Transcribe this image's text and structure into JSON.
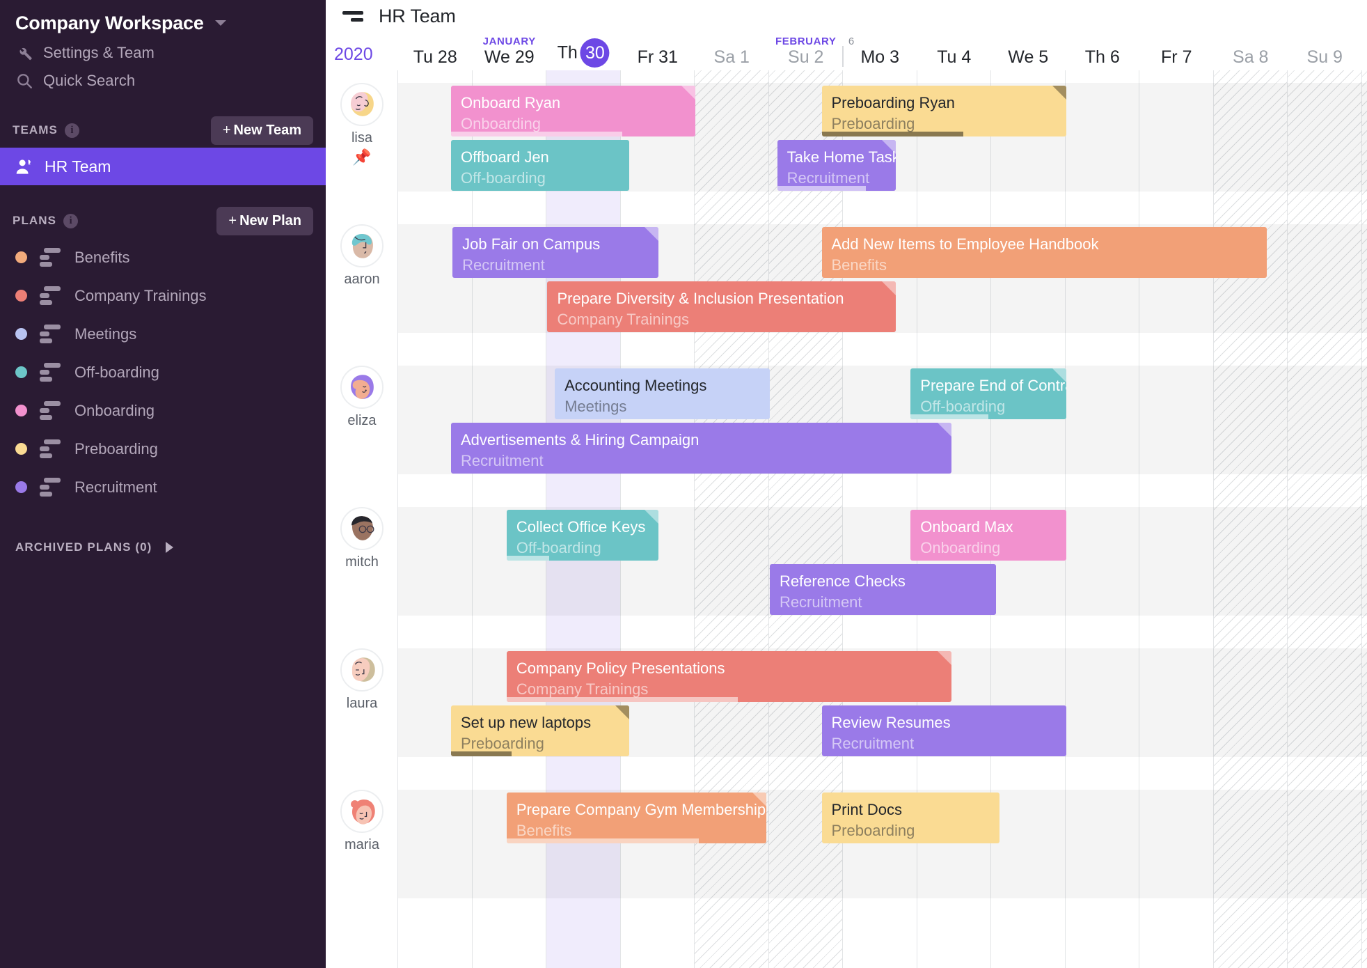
{
  "sidebar": {
    "workspace_title": "Company Workspace",
    "caret_icon": "chevron-down-icon",
    "links": [
      {
        "label": "Settings & Team",
        "icon": "wrench-icon"
      },
      {
        "label": "Quick Search",
        "icon": "search-icon"
      }
    ],
    "teams_section": {
      "title": "TEAMS",
      "info_icon": "info-icon",
      "new_button": "New Team",
      "plus": "+"
    },
    "teams": [
      {
        "label": "HR Team",
        "icon": "team-people-icon",
        "selected": true
      }
    ],
    "plans_section": {
      "title": "PLANS",
      "info_icon": "info-icon",
      "new_button": "New Plan",
      "plus": "+"
    },
    "plans": [
      {
        "label": "Benefits",
        "color": "#f2ab7c"
      },
      {
        "label": "Company Trainings",
        "color": "#ed7f76"
      },
      {
        "label": "Meetings",
        "color": "#b9c4f2"
      },
      {
        "label": "Off-boarding",
        "color": "#6cc6c8"
      },
      {
        "label": "Onboarding",
        "color": "#f291ce"
      },
      {
        "label": "Preboarding",
        "color": "#fadb93"
      },
      {
        "label": "Recruitment",
        "color": "#9a7ae8"
      }
    ],
    "archived": {
      "label": "ARCHIVED PLANS (0)",
      "arrow_icon": "chevron-right-icon"
    }
  },
  "header": {
    "sort_icon": "sort-lines-icon",
    "title": "HR Team"
  },
  "timeline": {
    "year": "2020",
    "months": [
      {
        "label": "JANUARY",
        "col": 1
      },
      {
        "label": "FEBRUARY",
        "col": 5
      }
    ],
    "week_number": "6",
    "week_sep_after_col": 6,
    "days": [
      {
        "label": "Tu 28",
        "weekend": false,
        "today": false
      },
      {
        "label": "We 29",
        "weekend": false,
        "today": false
      },
      {
        "label": "Th",
        "day": "30",
        "weekend": false,
        "today": true
      },
      {
        "label": "Fr 31",
        "weekend": false,
        "today": false
      },
      {
        "label": "Sa 1",
        "weekend": true,
        "today": false
      },
      {
        "label": "Su 2",
        "weekend": true,
        "today": false
      },
      {
        "label": "Mo 3",
        "weekend": false,
        "today": false
      },
      {
        "label": "Tu 4",
        "weekend": false,
        "today": false
      },
      {
        "label": "We 5",
        "weekend": false,
        "today": false
      },
      {
        "label": "Th 6",
        "weekend": false,
        "today": false
      },
      {
        "label": "Fr 7",
        "weekend": false,
        "today": false
      },
      {
        "label": "Sa 8",
        "weekend": true,
        "today": false
      },
      {
        "label": "Su 9",
        "weekend": true,
        "today": false
      }
    ]
  },
  "plan_colors": {
    "Benefits": "#f2a077",
    "Company Trainings": "#ec7f77",
    "Meetings": "#c6d2f7",
    "Off-boarding": "#6bc4c6",
    "Onboarding": "#f291ce",
    "Preboarding": "#fadb93",
    "Recruitment": "#9a7ae8"
  },
  "rows": [
    {
      "person": "lisa",
      "avatar": "avatar-lisa",
      "pinned": true,
      "pin_icon": "pushpin-icon",
      "tasks": [
        {
          "title": "Onboard Ryan",
          "plan": "Onboarding",
          "start": 1.0,
          "end": 4.3,
          "lane": 0,
          "progress": 70,
          "corner": true,
          "text": "light"
        },
        {
          "title": "Preboarding Ryan",
          "plan": "Preboarding",
          "start": 6.0,
          "end": 9.3,
          "lane": 0,
          "progress": 58,
          "corner": true,
          "text": "dark"
        },
        {
          "title": "Offboard Jen",
          "plan": "Off-boarding",
          "start": 1.0,
          "end": 3.4,
          "lane": 1,
          "progress": 0,
          "corner": false,
          "text": "light"
        },
        {
          "title": "Take Home Task",
          "plan": "Recruitment",
          "start": 5.4,
          "end": 7.0,
          "lane": 1,
          "progress": 75,
          "corner": true,
          "text": "light"
        }
      ]
    },
    {
      "person": "aaron",
      "avatar": "avatar-aaron",
      "pinned": false,
      "tasks": [
        {
          "title": "Job Fair on Campus",
          "plan": "Recruitment",
          "start": 1.02,
          "end": 3.8,
          "lane": 0,
          "progress": 0,
          "corner": true,
          "text": "light"
        },
        {
          "title": "Add New Items to Employee Handbook",
          "plan": "Benefits",
          "start": 6.0,
          "end": 12.0,
          "lane": 0,
          "progress": 0,
          "corner": false,
          "text": "light"
        },
        {
          "title": "Prepare Diversity & Inclusion Presentation",
          "plan": "Company Trainings",
          "start": 2.3,
          "end": 7.0,
          "lane": 1,
          "progress": 0,
          "corner": true,
          "text": "light"
        }
      ]
    },
    {
      "person": "eliza",
      "avatar": "avatar-eliza",
      "pinned": false,
      "tasks": [
        {
          "title": "Accounting Meetings",
          "plan": "Meetings",
          "start": 2.4,
          "end": 5.3,
          "lane": 0,
          "progress": 0,
          "corner": false,
          "text": "dark"
        },
        {
          "title": "Prepare End of Contract",
          "plan": "Off-boarding",
          "start": 7.2,
          "end": 9.3,
          "lane": 0,
          "progress": 50,
          "corner": true,
          "text": "light"
        },
        {
          "title": "Advertisements & Hiring Campaign",
          "plan": "Recruitment",
          "start": 1.0,
          "end": 7.75,
          "lane": 1,
          "progress": 0,
          "corner": true,
          "text": "light"
        }
      ]
    },
    {
      "person": "mitch",
      "avatar": "avatar-mitch",
      "pinned": false,
      "tasks": [
        {
          "title": "Collect Office Keys",
          "plan": "Off-boarding",
          "start": 1.75,
          "end": 3.8,
          "lane": 0,
          "progress": 28,
          "corner": true,
          "text": "light"
        },
        {
          "title": "Onboard Max",
          "plan": "Onboarding",
          "start": 7.2,
          "end": 9.3,
          "lane": 0,
          "progress": 0,
          "corner": false,
          "text": "light"
        },
        {
          "title": "Reference Checks",
          "plan": "Recruitment",
          "start": 5.3,
          "end": 8.35,
          "lane": 1,
          "progress": 0,
          "corner": false,
          "text": "light"
        }
      ]
    },
    {
      "person": "laura",
      "avatar": "avatar-laura",
      "pinned": false,
      "tasks": [
        {
          "title": "Company Policy Presentations",
          "plan": "Company Trainings",
          "start": 1.75,
          "end": 7.75,
          "lane": 0,
          "progress": 52,
          "corner": true,
          "text": "light"
        },
        {
          "title": "Set up new laptops",
          "plan": "Preboarding",
          "start": 1.0,
          "end": 3.4,
          "lane": 1,
          "progress": 34,
          "corner": true,
          "text": "dark"
        },
        {
          "title": "Review Resumes",
          "plan": "Recruitment",
          "start": 6.0,
          "end": 9.3,
          "lane": 1,
          "progress": 0,
          "corner": false,
          "text": "light"
        }
      ]
    },
    {
      "person": "maria",
      "avatar": "avatar-maria",
      "pinned": false,
      "tasks": [
        {
          "title": "Prepare Company Gym Memberships",
          "plan": "Benefits",
          "start": 1.75,
          "end": 5.25,
          "lane": 0,
          "progress": 74,
          "corner": true,
          "text": "light"
        },
        {
          "title": "Print Docs",
          "plan": "Preboarding",
          "start": 6.0,
          "end": 8.4,
          "lane": 0,
          "progress": 0,
          "corner": false,
          "text": "dark"
        }
      ]
    }
  ]
}
